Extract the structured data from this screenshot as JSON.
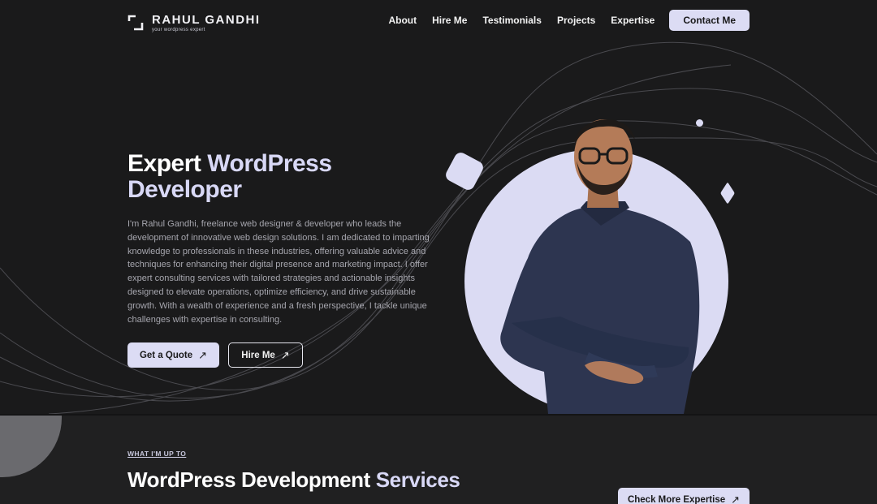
{
  "brand": {
    "name": "RAHUL GANDHI",
    "tagline": "your wordpress expert"
  },
  "nav": {
    "items": [
      {
        "label": "About"
      },
      {
        "label": "Hire Me"
      },
      {
        "label": "Testimonials"
      },
      {
        "label": "Projects"
      },
      {
        "label": "Expertise"
      }
    ],
    "cta": "Contact Me"
  },
  "hero": {
    "title_part1": "Expert ",
    "title_accent": "WordPress",
    "title_part2": "Developer",
    "description": "I'm Rahul Gandhi, freelance web designer & developer who leads the development of innovative web design solutions. I am dedicated to imparting knowledge to professionals in these industries, offering valuable advice and techniques for enhancing their digital presence and marketing impact. I offer expert consulting services with tailored strategies and actionable insights designed to elevate operations, optimize efficiency, and drive sustainable growth. With a wealth of experience and a fresh perspective, I tackle unique challenges with expertise in consulting.",
    "primary_button": "Get a Quote",
    "secondary_button": "Hire Me",
    "arrow_icon": "arrow-up-right-icon"
  },
  "services": {
    "eyebrow": "WHAT I'M UP TO",
    "title_part1": "WordPress Development ",
    "title_accent": "Services",
    "button": "Check More Expertise"
  },
  "colors": {
    "background": "#1a1a1b",
    "accent": "#dcdcf4",
    "text_muted": "#a6a6ae"
  }
}
